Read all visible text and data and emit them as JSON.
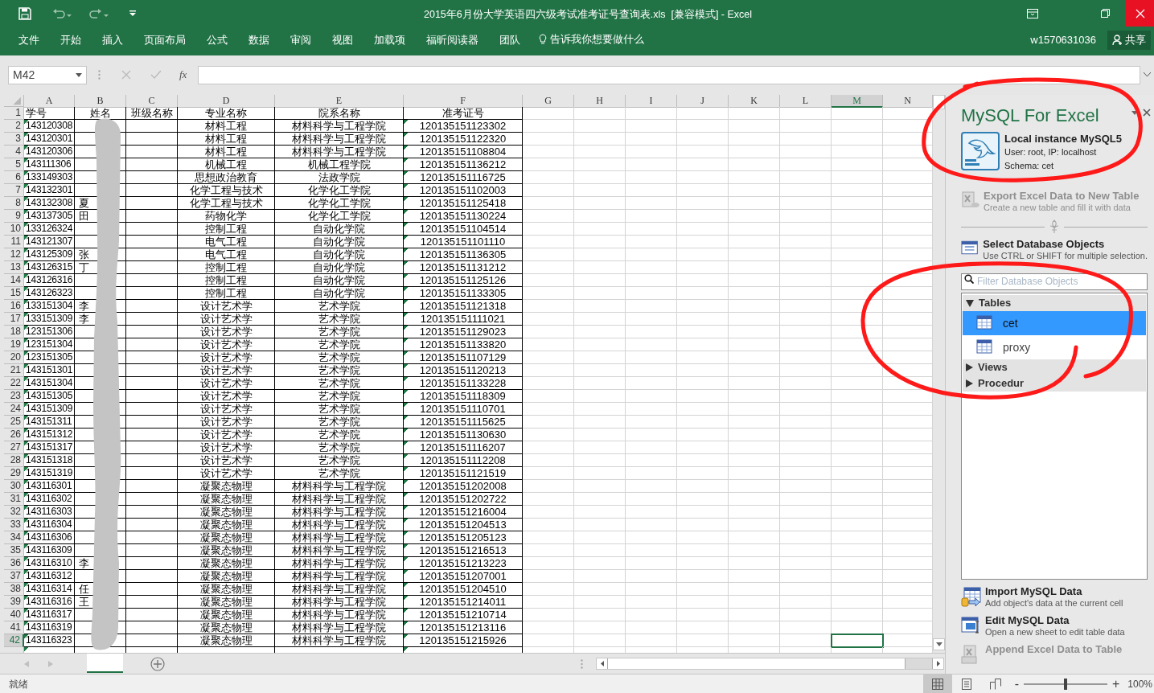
{
  "window": {
    "title": "2015年6月份大学英语四六级考试准考证号查询表.xls  [兼容模式] - Excel"
  },
  "ribbon": {
    "tabs": [
      {
        "label": "文件",
        "selected": false
      },
      {
        "label": "开始",
        "selected": false
      },
      {
        "label": "插入",
        "selected": false
      },
      {
        "label": "页面布局",
        "selected": false
      },
      {
        "label": "公式",
        "selected": false
      },
      {
        "label": "数据",
        "selected": false
      },
      {
        "label": "审阅",
        "selected": false
      },
      {
        "label": "视图",
        "selected": false
      },
      {
        "label": "加载项",
        "selected": false
      },
      {
        "label": "福昕阅读器",
        "selected": false
      },
      {
        "label": "团队",
        "selected": false
      }
    ],
    "tell_me": "告诉我你想要做什么",
    "user": "w1570631036",
    "share": "共享"
  },
  "formula_bar": {
    "name_box": "M42",
    "fx": "fx"
  },
  "sheet": {
    "header_row_number": "1",
    "columns": [
      {
        "letter": "A",
        "header": "学号",
        "selected": false
      },
      {
        "letter": "B",
        "header": "姓名",
        "selected": false
      },
      {
        "letter": "C",
        "header": "班级名称",
        "selected": false
      },
      {
        "letter": "D",
        "header": "专业名称",
        "selected": false
      },
      {
        "letter": "E",
        "header": "院系名称",
        "selected": false
      },
      {
        "letter": "F",
        "header": "准考证号",
        "selected": false
      },
      {
        "letter": "G",
        "selected": false
      },
      {
        "letter": "H",
        "selected": false
      },
      {
        "letter": "I",
        "selected": false
      },
      {
        "letter": "J",
        "selected": false
      },
      {
        "letter": "K",
        "selected": false
      },
      {
        "letter": "L",
        "selected": false
      },
      {
        "letter": "M",
        "selected": true
      },
      {
        "letter": "N",
        "selected": false
      }
    ],
    "rows": [
      {
        "num": "2",
        "id": "143120308",
        "major": "材料工程",
        "dept": "材料科学与工程学院",
        "ticket": "120135151123302",
        "selected": false
      },
      {
        "num": "3",
        "id": "143120301",
        "major": "材料工程",
        "dept": "材料科学与工程学院",
        "ticket": "120135151122320",
        "selected": false
      },
      {
        "num": "4",
        "id": "143120306",
        "major": "材料工程",
        "dept": "材料科学与工程学院",
        "ticket": "120135151108804",
        "selected": false
      },
      {
        "num": "5",
        "id": "143111306",
        "major": "机械工程",
        "dept": "机械工程学院",
        "ticket": "120135151136212",
        "selected": false
      },
      {
        "num": "6",
        "id": "133149303",
        "major": "思想政治教育",
        "dept": "法政学院",
        "ticket": "120135151116725",
        "selected": false
      },
      {
        "num": "7",
        "id": "143132301",
        "major": "化学工程与技术",
        "dept": "化学化工学院",
        "ticket": "120135151102003",
        "selected": false
      },
      {
        "num": "8",
        "id": "143132308",
        "surname": "夏",
        "major": "化学工程与技术",
        "dept": "化学化工学院",
        "ticket": "120135151125418",
        "selected": false
      },
      {
        "num": "9",
        "id": "143137305",
        "surname": "田",
        "major": "药物化学",
        "dept": "化学化工学院",
        "ticket": "120135151130224",
        "selected": false
      },
      {
        "num": "10",
        "id": "133126324",
        "major": "控制工程",
        "dept": "自动化学院",
        "ticket": "120135151104514",
        "selected": false
      },
      {
        "num": "11",
        "id": "143121307",
        "major": "电气工程",
        "dept": "自动化学院",
        "ticket": "120135151101110",
        "selected": false
      },
      {
        "num": "12",
        "id": "143125309",
        "surname": "张",
        "major": "电气工程",
        "dept": "自动化学院",
        "ticket": "120135151136305",
        "selected": false
      },
      {
        "num": "13",
        "id": "143126315",
        "surname": "丁",
        "major": "控制工程",
        "dept": "自动化学院",
        "ticket": "120135151131212",
        "selected": false
      },
      {
        "num": "14",
        "id": "143126316",
        "major": "控制工程",
        "dept": "自动化学院",
        "ticket": "120135151125126",
        "selected": false
      },
      {
        "num": "15",
        "id": "143126323",
        "major": "控制工程",
        "dept": "自动化学院",
        "ticket": "120135151133305",
        "selected": false
      },
      {
        "num": "16",
        "id": "133151304",
        "surname": "李",
        "major": "设计艺术学",
        "dept": "艺术学院",
        "ticket": "120135151121318",
        "selected": false
      },
      {
        "num": "17",
        "id": "133151309",
        "surname": "李",
        "major": "设计艺术学",
        "dept": "艺术学院",
        "ticket": "120135151111021",
        "selected": false
      },
      {
        "num": "18",
        "id": "123151306",
        "major": "设计艺术学",
        "dept": "艺术学院",
        "ticket": "120135151129023",
        "selected": false
      },
      {
        "num": "19",
        "id": "123151304",
        "major": "设计艺术学",
        "dept": "艺术学院",
        "ticket": "120135151133820",
        "selected": false
      },
      {
        "num": "20",
        "id": "123151305",
        "major": "设计艺术学",
        "dept": "艺术学院",
        "ticket": "120135151107129",
        "selected": false
      },
      {
        "num": "21",
        "id": "143151301",
        "major": "设计艺术学",
        "dept": "艺术学院",
        "ticket": "120135151120213",
        "selected": false
      },
      {
        "num": "22",
        "id": "143151304",
        "major": "设计艺术学",
        "dept": "艺术学院",
        "ticket": "120135151133228",
        "selected": false
      },
      {
        "num": "23",
        "id": "143151305",
        "major": "设计艺术学",
        "dept": "艺术学院",
        "ticket": "120135151118309",
        "selected": false
      },
      {
        "num": "24",
        "id": "143151309",
        "major": "设计艺术学",
        "dept": "艺术学院",
        "ticket": "120135151110701",
        "selected": false
      },
      {
        "num": "25",
        "id": "143151311",
        "major": "设计艺术学",
        "dept": "艺术学院",
        "ticket": "120135151115625",
        "selected": false
      },
      {
        "num": "26",
        "id": "143151312",
        "major": "设计艺术学",
        "dept": "艺术学院",
        "ticket": "120135151130630",
        "selected": false
      },
      {
        "num": "27",
        "id": "143151317",
        "major": "设计艺术学",
        "dept": "艺术学院",
        "ticket": "120135151116207",
        "selected": false
      },
      {
        "num": "28",
        "id": "143151318",
        "major": "设计艺术学",
        "dept": "艺术学院",
        "ticket": "120135151112208",
        "selected": false
      },
      {
        "num": "29",
        "id": "143151319",
        "major": "设计艺术学",
        "dept": "艺术学院",
        "ticket": "120135151121519",
        "selected": false
      },
      {
        "num": "30",
        "id": "143116301",
        "major": "凝聚态物理",
        "dept": "材料科学与工程学院",
        "ticket": "120135151202008",
        "selected": false
      },
      {
        "num": "31",
        "id": "143116302",
        "major": "凝聚态物理",
        "dept": "材料科学与工程学院",
        "ticket": "120135151202722",
        "selected": false
      },
      {
        "num": "32",
        "id": "143116303",
        "major": "凝聚态物理",
        "dept": "材料科学与工程学院",
        "ticket": "120135151216004",
        "selected": false
      },
      {
        "num": "33",
        "id": "143116304",
        "major": "凝聚态物理",
        "dept": "材料科学与工程学院",
        "ticket": "120135151204513",
        "selected": false
      },
      {
        "num": "34",
        "id": "143116306",
        "major": "凝聚态物理",
        "dept": "材料科学与工程学院",
        "ticket": "120135151205123",
        "selected": false
      },
      {
        "num": "35",
        "id": "143116309",
        "major": "凝聚态物理",
        "dept": "材料科学与工程学院",
        "ticket": "120135151216513",
        "selected": false
      },
      {
        "num": "36",
        "id": "143116310",
        "surname": "李",
        "major": "凝聚态物理",
        "dept": "材料科学与工程学院",
        "ticket": "120135151213223",
        "selected": false
      },
      {
        "num": "37",
        "id": "143116312",
        "major": "凝聚态物理",
        "dept": "材料科学与工程学院",
        "ticket": "120135151207001",
        "selected": false
      },
      {
        "num": "38",
        "id": "143116314",
        "surname": "任",
        "major": "凝聚态物理",
        "dept": "材料科学与工程学院",
        "ticket": "120135151204510",
        "selected": false
      },
      {
        "num": "39",
        "id": "143116316",
        "surname": "王",
        "major": "凝聚态物理",
        "dept": "材料科学与工程学院",
        "ticket": "120135151214011",
        "selected": false
      },
      {
        "num": "40",
        "id": "143116317",
        "major": "凝聚态物理",
        "dept": "材料科学与工程学院",
        "ticket": "120135151210714",
        "selected": false
      },
      {
        "num": "41",
        "id": "143116319",
        "major": "凝聚态物理",
        "dept": "材料科学与工程学院",
        "ticket": "120135151213116",
        "selected": false
      },
      {
        "num": "42",
        "id": "143116323",
        "major": "凝聚态物理",
        "dept": "材料科学与工程学院",
        "ticket": "120135151215926",
        "selected": true
      }
    ]
  },
  "panel": {
    "title": "MySQL For Excel",
    "connection": {
      "name": "Local instance MySQL5",
      "user": "User: root, IP: localhost",
      "schema": "Schema: cet"
    },
    "export": {
      "title": "Export Excel Data to New Table",
      "subtitle": "Create a new table and fill it with data",
      "disabled": true
    },
    "select": {
      "title": "Select Database Objects",
      "subtitle": "Use CTRL or SHIFT for multiple selection."
    },
    "filter": {
      "placeholder": "Filter Database Objects"
    },
    "tree": [
      {
        "label": "Tables",
        "expanded": true,
        "children": [
          {
            "label": "cet",
            "selected": true
          },
          {
            "label": "proxy",
            "selected": false
          }
        ]
      },
      {
        "label": "Views",
        "expanded": false
      },
      {
        "label": "Procedur",
        "expanded": false
      }
    ],
    "actions": [
      {
        "kind": "import",
        "title": "Import MySQL Data",
        "subtitle": "Add object's data at the current cell",
        "disabled": false
      },
      {
        "kind": "edit",
        "title": "Edit MySQL Data",
        "subtitle": "Open a new sheet to edit table data",
        "disabled": false
      },
      {
        "kind": "append",
        "title": "Append Excel Data to Table",
        "disabled": true
      }
    ]
  },
  "status_bar": {
    "text": "就绪",
    "zoom": "100%",
    "zoom_out": "-",
    "zoom_in": "+",
    "zoom_slider": {
      "level": 0.5
    },
    "view_modes": [
      {
        "kind": "normal",
        "selected": true
      },
      {
        "kind": "page-layout",
        "selected": false
      },
      {
        "kind": "page-break",
        "selected": false
      }
    ]
  }
}
